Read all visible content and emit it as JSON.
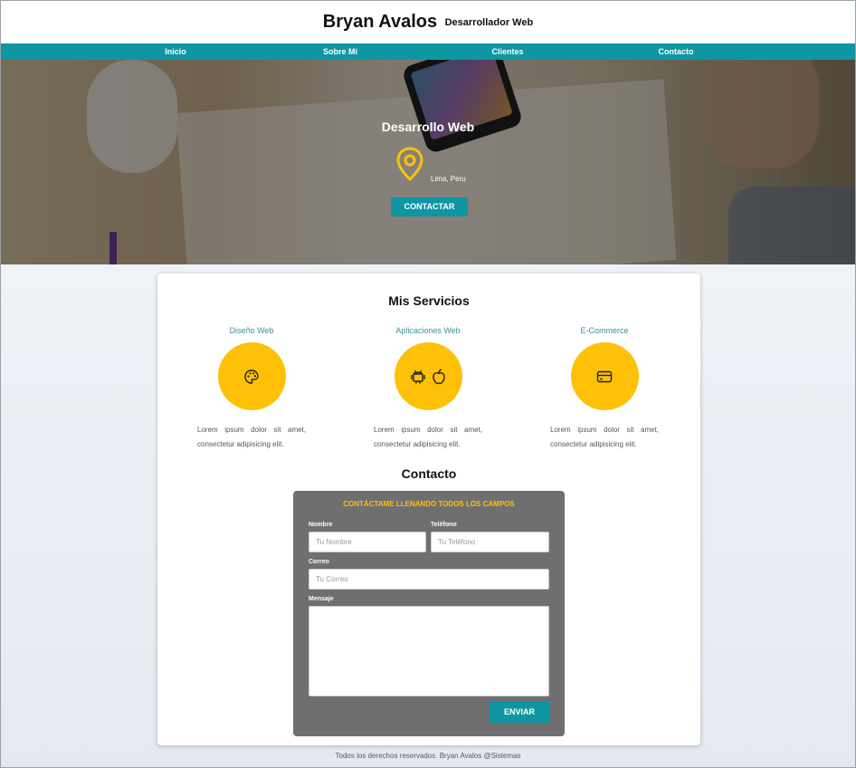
{
  "header": {
    "name": "Bryan Avalos",
    "role": "Desarrollador Web"
  },
  "nav": {
    "items": [
      {
        "label": "Inicio"
      },
      {
        "label": "Sobre Mí"
      },
      {
        "label": "Clientes"
      },
      {
        "label": "Contacto"
      }
    ]
  },
  "hero": {
    "title": "Desarrollo Web",
    "location": "Lima, Peru",
    "cta_label": "CONTACTAR",
    "pin_icon": "map-pin-icon"
  },
  "services": {
    "title": "Mis Servicios",
    "items": [
      {
        "name": "Diseño Web",
        "icon": "palette-icon",
        "text": "Lorem ipsum dolor sit amet, consectetur adipisicing elit."
      },
      {
        "name": "Aplicaciones Web",
        "icon": "android-apple-icons",
        "text": "Lorem ipsum dolor sit amet, consectetur adipisicing elit."
      },
      {
        "name": "E-Commerce",
        "icon": "credit-card-icon",
        "text": "Lorem ipsum dolor sit amet, consectetur adipisicing elit."
      }
    ]
  },
  "contact": {
    "title": "Contacto",
    "form_heading": "CONTÁCTAME LLENANDO TODOS LOS CAMPOS",
    "fields": {
      "nombre": {
        "label": "Nombre",
        "placeholder": "Tu Nombre"
      },
      "telefono": {
        "label": "Teléfono",
        "placeholder": "Tu Teléfono"
      },
      "correo": {
        "label": "Correo",
        "placeholder": "Tu Correo"
      },
      "mensaje": {
        "label": "Mensaje",
        "placeholder": ""
      }
    },
    "submit_label": "ENVIAR"
  },
  "footer": {
    "text": "Todos los derechos reservados. Bryan Avalos @Sistemas"
  },
  "colors": {
    "accent": "#0e97a3",
    "highlight": "#ffc107",
    "form_bg": "#6f6f6f"
  }
}
